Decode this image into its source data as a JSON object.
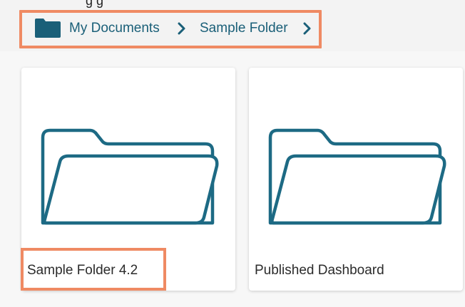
{
  "caption_fragment": "g                              g",
  "breadcrumb": {
    "items": [
      {
        "label": "My Documents"
      },
      {
        "label": "Sample Folder"
      }
    ]
  },
  "folders": [
    {
      "name": "Sample Folder 4.2"
    },
    {
      "name": "Published Dashboard"
    }
  ],
  "colors": {
    "accent": "#1a5f78",
    "highlight": "#ef8a63",
    "folder_stroke": "#1d6a84"
  },
  "icons": {
    "breadcrumb_root": "folder-filled-icon",
    "separator": "chevron-right-icon",
    "card_folder": "folder-outline-icon"
  }
}
